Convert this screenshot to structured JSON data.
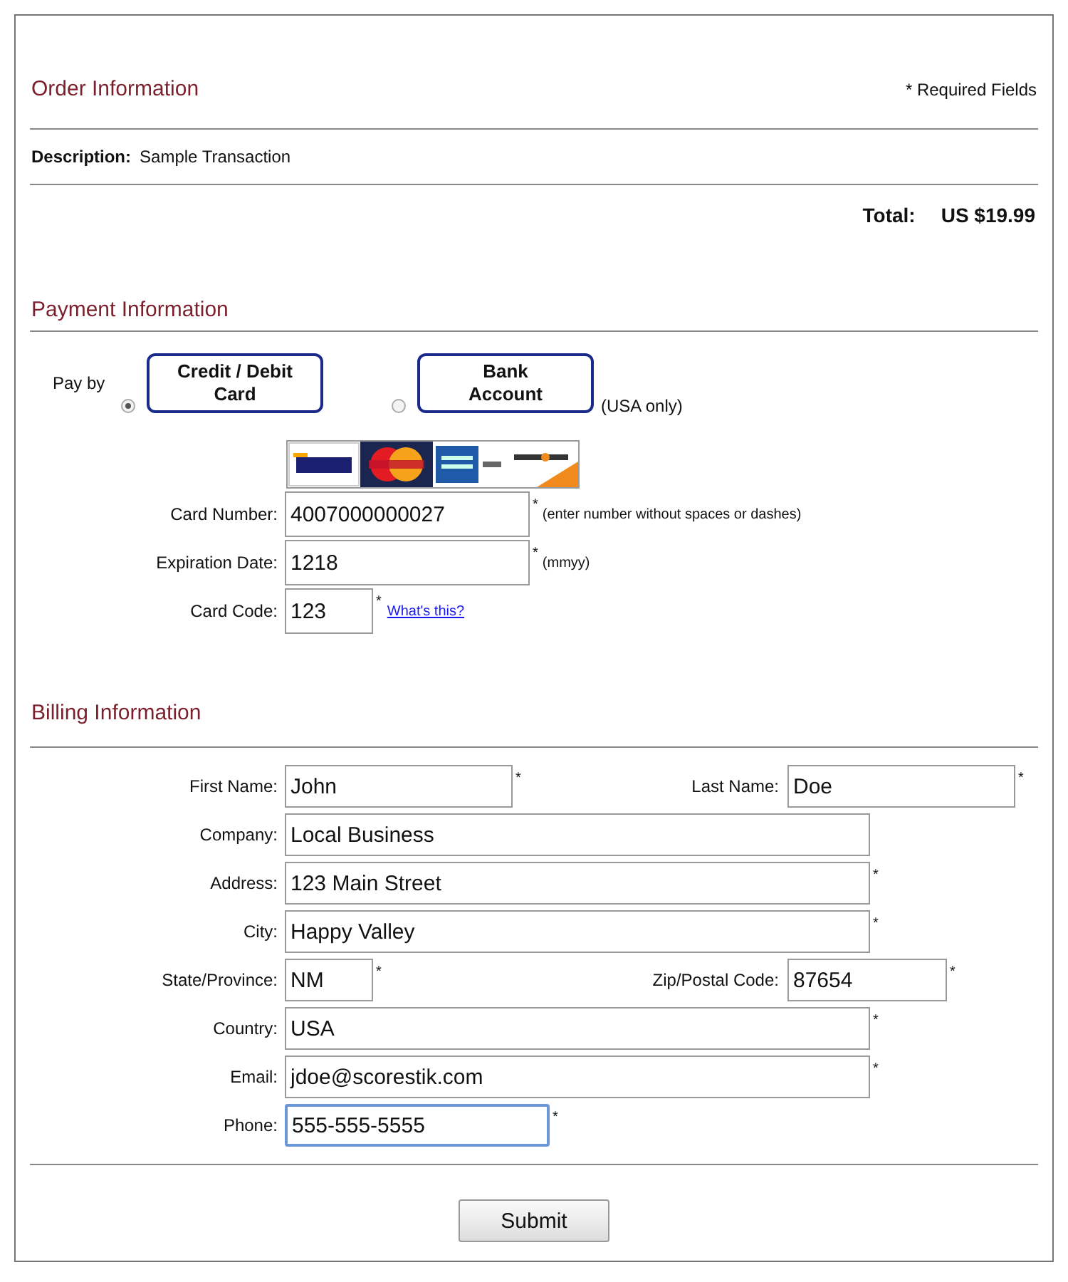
{
  "order": {
    "title": "Order Information",
    "required_note": "* Required Fields",
    "description_label": "Description:",
    "description": "Sample Transaction",
    "total_label": "Total:",
    "total": "US $19.99"
  },
  "payment": {
    "title": "Payment Information",
    "pay_by": "Pay by",
    "methods": [
      {
        "lines": [
          "Credit / Debit",
          "Card"
        ],
        "selected": true
      },
      {
        "lines": [
          "Bank",
          "Account"
        ],
        "selected": false,
        "note": "(USA only)"
      }
    ],
    "card_fields": [
      {
        "label": "Card Number:",
        "value": "4007000000027",
        "kind": "wide",
        "mark": "*",
        "hint": "(enter number without spaces or dashes)"
      },
      {
        "label": "Expiration Date:",
        "value": "1218",
        "kind": "wide",
        "mark": "*",
        "hint": "(mmyy)"
      },
      {
        "label": "Card Code:",
        "value": "123",
        "kind": "tiny",
        "mark": "*",
        "link": "What's this?"
      }
    ]
  },
  "billing": {
    "title": "Billing Information",
    "rows": [
      [
        {
          "label": "First Name:",
          "value": "John",
          "kind": "medium",
          "mark": "*"
        },
        {
          "label": "Last Name:",
          "value": "Doe",
          "kind": "medium",
          "mark": "*"
        }
      ],
      [
        {
          "label": "Company:",
          "value": "Local Business",
          "kind": "long"
        }
      ],
      [
        {
          "label": "Address:",
          "value": "123 Main Street",
          "kind": "long",
          "mark": "*"
        }
      ],
      [
        {
          "label": "City:",
          "value": "Happy Valley",
          "kind": "long",
          "mark": "*"
        }
      ],
      [
        {
          "label": "State/Province:",
          "value": "NM",
          "kind": "tiny",
          "mark": "*"
        },
        {
          "label": "Zip/Postal Code:",
          "value": "87654",
          "kind": "small",
          "mark": "*"
        }
      ],
      [
        {
          "label": "Country:",
          "value": "USA",
          "kind": "long",
          "mark": "*"
        }
      ],
      [
        {
          "label": "Email:",
          "value": "jdoe@scorestik.com",
          "kind": "long",
          "mark": "*"
        }
      ],
      [
        {
          "label": "Phone:",
          "value": "555-555-5555",
          "kind": "phone",
          "mark": "*",
          "focused": true
        }
      ]
    ]
  },
  "submit": "Submit"
}
